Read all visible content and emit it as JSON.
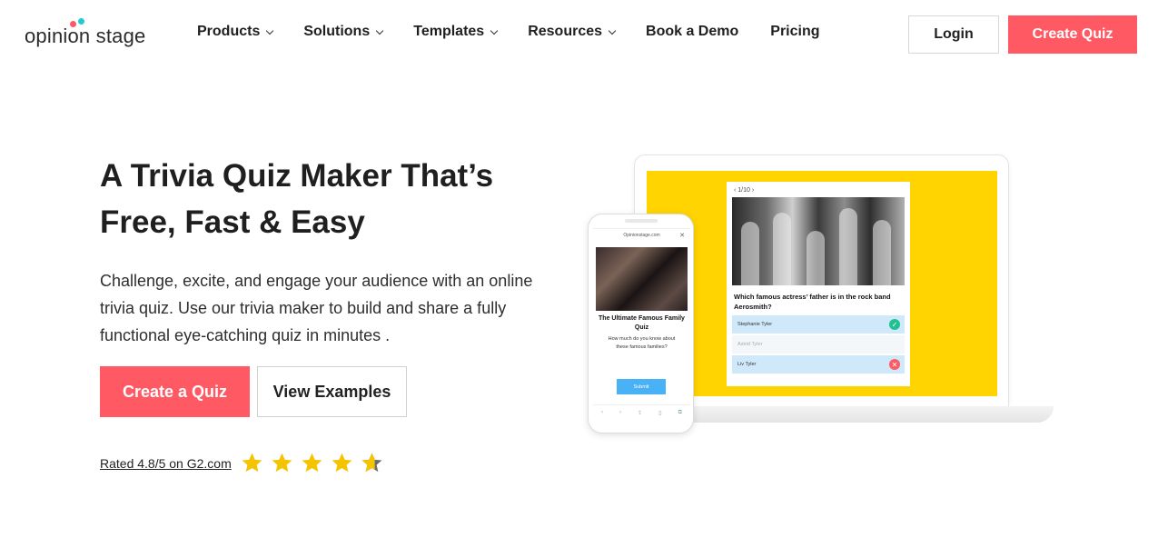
{
  "header": {
    "logo_text": "opinion stage",
    "nav": [
      {
        "label": "Products",
        "has_dropdown": true
      },
      {
        "label": "Solutions",
        "has_dropdown": true
      },
      {
        "label": "Templates",
        "has_dropdown": true
      },
      {
        "label": "Resources",
        "has_dropdown": true
      },
      {
        "label": "Book a Demo",
        "has_dropdown": false
      },
      {
        "label": "Pricing",
        "has_dropdown": false
      }
    ],
    "login_label": "Login",
    "create_quiz_label": "Create Quiz"
  },
  "hero": {
    "title_line1": "A Trivia Quiz Maker That’s",
    "title_line2": "Free, Fast & Easy",
    "description": "Challenge, excite, and engage your audience with an online trivia quiz. Use our trivia maker to build and share a fully functional eye-catching quiz in minutes .",
    "primary_cta": "Create a Quiz",
    "secondary_cta": "View Examples",
    "rating_text": "Rated 4.8/5 on G2.com",
    "rating_value": 4.8,
    "rating_max": 5
  },
  "laptop_quiz": {
    "counter": "‹ 1/10 ›",
    "question": "Which famous actress’ father is in the rock band Aerosmith?",
    "answers": [
      {
        "label": "Stephanie Tyler",
        "state": "correct"
      },
      {
        "label": "Astrid Tyler",
        "state": "neutral"
      },
      {
        "label": "Liv Tyler",
        "state": "wrong"
      }
    ]
  },
  "phone_quiz": {
    "url": "Opinionstage.com",
    "close": "✕",
    "title": "The Ultimate Famous Family Quiz",
    "subtitle": "How much do you know about these famous families?",
    "submit": "Submit",
    "toolbar_icons": [
      "‹",
      "›",
      "⇪",
      "▯",
      "⧉"
    ]
  },
  "colors": {
    "brand_red": "#ff5a64",
    "brand_teal": "#25c9cf",
    "star_yellow": "#f5c400",
    "screen_yellow": "#ffd400",
    "answer_blue": "#cfe9fb"
  }
}
